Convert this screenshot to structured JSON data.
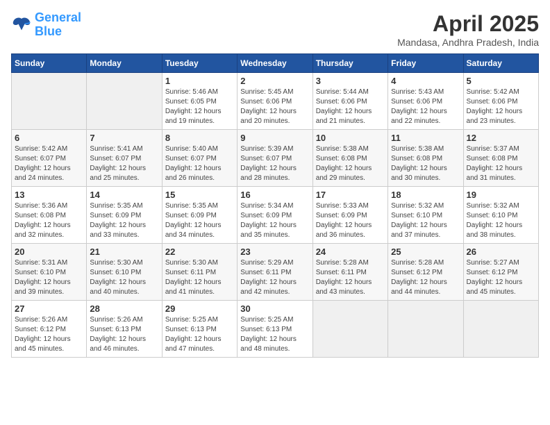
{
  "header": {
    "logo_line1": "General",
    "logo_line2": "Blue",
    "month_title": "April 2025",
    "location": "Mandasa, Andhra Pradesh, India"
  },
  "weekdays": [
    "Sunday",
    "Monday",
    "Tuesday",
    "Wednesday",
    "Thursday",
    "Friday",
    "Saturday"
  ],
  "weeks": [
    [
      {
        "day": "",
        "info": ""
      },
      {
        "day": "",
        "info": ""
      },
      {
        "day": "1",
        "info": "Sunrise: 5:46 AM\nSunset: 6:05 PM\nDaylight: 12 hours and 19 minutes."
      },
      {
        "day": "2",
        "info": "Sunrise: 5:45 AM\nSunset: 6:06 PM\nDaylight: 12 hours and 20 minutes."
      },
      {
        "day": "3",
        "info": "Sunrise: 5:44 AM\nSunset: 6:06 PM\nDaylight: 12 hours and 21 minutes."
      },
      {
        "day": "4",
        "info": "Sunrise: 5:43 AM\nSunset: 6:06 PM\nDaylight: 12 hours and 22 minutes."
      },
      {
        "day": "5",
        "info": "Sunrise: 5:42 AM\nSunset: 6:06 PM\nDaylight: 12 hours and 23 minutes."
      }
    ],
    [
      {
        "day": "6",
        "info": "Sunrise: 5:42 AM\nSunset: 6:07 PM\nDaylight: 12 hours and 24 minutes."
      },
      {
        "day": "7",
        "info": "Sunrise: 5:41 AM\nSunset: 6:07 PM\nDaylight: 12 hours and 25 minutes."
      },
      {
        "day": "8",
        "info": "Sunrise: 5:40 AM\nSunset: 6:07 PM\nDaylight: 12 hours and 26 minutes."
      },
      {
        "day": "9",
        "info": "Sunrise: 5:39 AM\nSunset: 6:07 PM\nDaylight: 12 hours and 28 minutes."
      },
      {
        "day": "10",
        "info": "Sunrise: 5:38 AM\nSunset: 6:08 PM\nDaylight: 12 hours and 29 minutes."
      },
      {
        "day": "11",
        "info": "Sunrise: 5:38 AM\nSunset: 6:08 PM\nDaylight: 12 hours and 30 minutes."
      },
      {
        "day": "12",
        "info": "Sunrise: 5:37 AM\nSunset: 6:08 PM\nDaylight: 12 hours and 31 minutes."
      }
    ],
    [
      {
        "day": "13",
        "info": "Sunrise: 5:36 AM\nSunset: 6:08 PM\nDaylight: 12 hours and 32 minutes."
      },
      {
        "day": "14",
        "info": "Sunrise: 5:35 AM\nSunset: 6:09 PM\nDaylight: 12 hours and 33 minutes."
      },
      {
        "day": "15",
        "info": "Sunrise: 5:35 AM\nSunset: 6:09 PM\nDaylight: 12 hours and 34 minutes."
      },
      {
        "day": "16",
        "info": "Sunrise: 5:34 AM\nSunset: 6:09 PM\nDaylight: 12 hours and 35 minutes."
      },
      {
        "day": "17",
        "info": "Sunrise: 5:33 AM\nSunset: 6:09 PM\nDaylight: 12 hours and 36 minutes."
      },
      {
        "day": "18",
        "info": "Sunrise: 5:32 AM\nSunset: 6:10 PM\nDaylight: 12 hours and 37 minutes."
      },
      {
        "day": "19",
        "info": "Sunrise: 5:32 AM\nSunset: 6:10 PM\nDaylight: 12 hours and 38 minutes."
      }
    ],
    [
      {
        "day": "20",
        "info": "Sunrise: 5:31 AM\nSunset: 6:10 PM\nDaylight: 12 hours and 39 minutes."
      },
      {
        "day": "21",
        "info": "Sunrise: 5:30 AM\nSunset: 6:10 PM\nDaylight: 12 hours and 40 minutes."
      },
      {
        "day": "22",
        "info": "Sunrise: 5:30 AM\nSunset: 6:11 PM\nDaylight: 12 hours and 41 minutes."
      },
      {
        "day": "23",
        "info": "Sunrise: 5:29 AM\nSunset: 6:11 PM\nDaylight: 12 hours and 42 minutes."
      },
      {
        "day": "24",
        "info": "Sunrise: 5:28 AM\nSunset: 6:11 PM\nDaylight: 12 hours and 43 minutes."
      },
      {
        "day": "25",
        "info": "Sunrise: 5:28 AM\nSunset: 6:12 PM\nDaylight: 12 hours and 44 minutes."
      },
      {
        "day": "26",
        "info": "Sunrise: 5:27 AM\nSunset: 6:12 PM\nDaylight: 12 hours and 45 minutes."
      }
    ],
    [
      {
        "day": "27",
        "info": "Sunrise: 5:26 AM\nSunset: 6:12 PM\nDaylight: 12 hours and 45 minutes."
      },
      {
        "day": "28",
        "info": "Sunrise: 5:26 AM\nSunset: 6:13 PM\nDaylight: 12 hours and 46 minutes."
      },
      {
        "day": "29",
        "info": "Sunrise: 5:25 AM\nSunset: 6:13 PM\nDaylight: 12 hours and 47 minutes."
      },
      {
        "day": "30",
        "info": "Sunrise: 5:25 AM\nSunset: 6:13 PM\nDaylight: 12 hours and 48 minutes."
      },
      {
        "day": "",
        "info": ""
      },
      {
        "day": "",
        "info": ""
      },
      {
        "day": "",
        "info": ""
      }
    ]
  ]
}
